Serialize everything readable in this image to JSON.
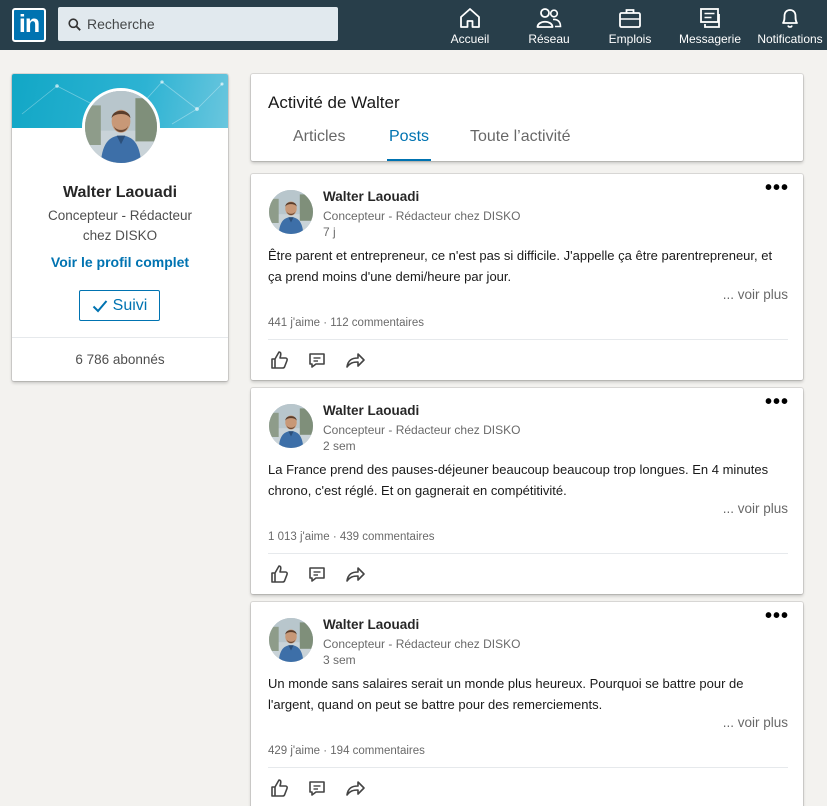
{
  "nav": {
    "logo": "in",
    "search_placeholder": "Recherche",
    "items": [
      {
        "label": "Accueil",
        "icon": "home-icon"
      },
      {
        "label": "Réseau",
        "icon": "network-icon"
      },
      {
        "label": "Emplois",
        "icon": "briefcase-icon"
      },
      {
        "label": "Messagerie",
        "icon": "messaging-icon"
      },
      {
        "label": "Notifications",
        "icon": "bell-icon"
      }
    ]
  },
  "profile": {
    "name": "Walter Laouadi",
    "headline": "Concepteur - Rédacteur chez DISKO",
    "view_profile": "Voir le profil complet",
    "follow_label": "Suivi",
    "followers": "6 786 abonnés"
  },
  "activity": {
    "title": "Activité de Walter",
    "tabs": [
      {
        "label": "Articles",
        "active": false
      },
      {
        "label": "Posts",
        "active": true
      },
      {
        "label": "Toute l’activité",
        "active": false
      }
    ]
  },
  "posts": [
    {
      "author": "Walter Laouadi",
      "headline": "Concepteur - Rédacteur chez DISKO",
      "time": "7 j",
      "text": "Être parent et entrepreneur, ce n'est pas si difficile. J'appelle ça être parentrepreneur, et ça prend moins d'une demi/heure par jour.",
      "more": "... voir plus",
      "stats": "441 j'aime · 112 commentaires"
    },
    {
      "author": "Walter Laouadi",
      "headline": "Concepteur - Rédacteur chez DISKO",
      "time": "2 sem",
      "text": "La France prend des pauses-déjeuner beaucoup beaucoup trop longues. En 4 minutes chrono, c'est réglé. Et on gagnerait en compétitivité.",
      "more": "... voir plus",
      "stats": "1 013 j'aime · 439 commentaires"
    },
    {
      "author": "Walter Laouadi",
      "headline": "Concepteur - Rédacteur chez DISKO",
      "time": "3 sem",
      "text": "Un monde sans salaires serait un monde plus heureux. Pourquoi se battre pour de l'argent, quand on peut se battre pour des remerciements.",
      "more": "... voir plus",
      "stats": "429 j'aime · 194 commentaires"
    }
  ],
  "colors": {
    "nav_bg": "#283e4a",
    "brand_blue": "#0073b1",
    "page_bg": "#f3f2ef"
  }
}
